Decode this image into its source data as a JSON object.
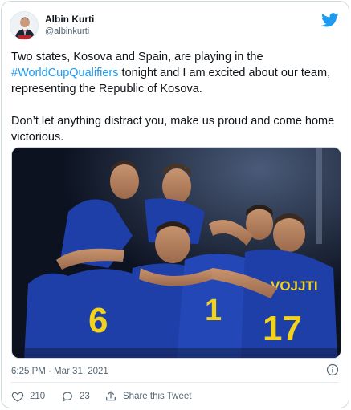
{
  "tweet": {
    "author": {
      "display_name": "Albin Kurti",
      "handle": "@albinkurti",
      "avatar_icon": "profile-photo"
    },
    "text": {
      "line1_before": "Two states, Kosova and Spain, are playing in the",
      "hashtag": "#WorldCupQualifiers",
      "line2_after": " tonight and I am excited about our team, representing the Republic of Kosova.",
      "paragraph2": "Don’t let anything distract you, make us proud and come home victorious."
    },
    "timestamp": "6:25 PM · Mar 31, 2021",
    "likes": "210",
    "replies": "23",
    "share_label": "Share this Tweet",
    "brand_icon": "twitter-bird-icon",
    "colors": {
      "accent": "#1d9bf0",
      "kit_blue": "#1f3fa8",
      "kit_yellow": "#f2d21b"
    }
  }
}
